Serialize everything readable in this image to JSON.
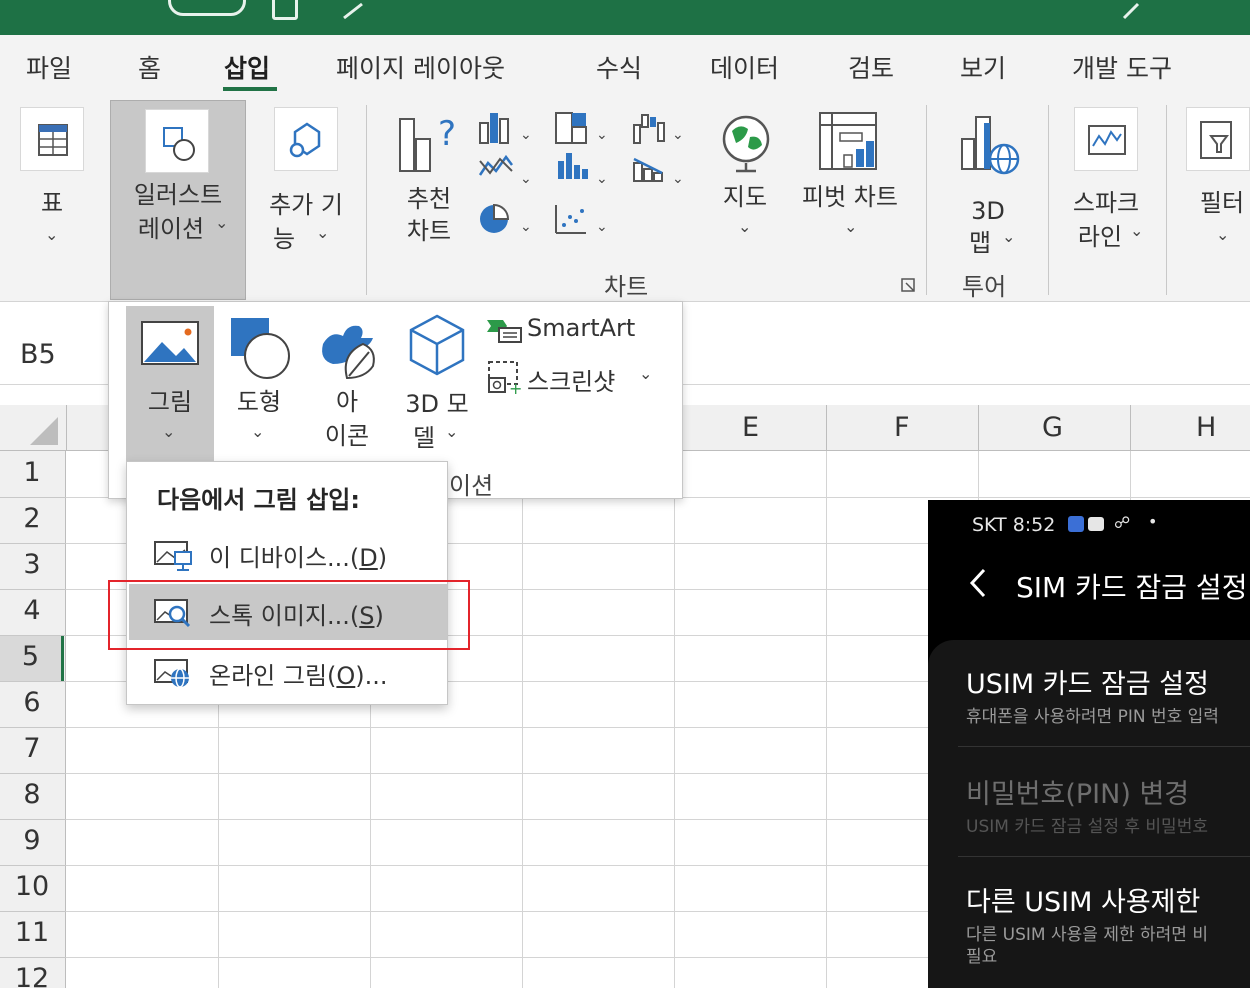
{
  "tabs": [
    "파일",
    "홈",
    "삽입",
    "페이지 레이아웃",
    "수식",
    "데이터",
    "검토",
    "보기",
    "개발 도구"
  ],
  "active_tab": "삽입",
  "ribbon": {
    "table": "표",
    "illustrations": [
      "일러스트",
      "레이션"
    ],
    "addins": [
      "추가 기",
      "능"
    ],
    "recommended_charts": [
      "추천",
      "차트"
    ],
    "maps": "지도",
    "pivot_chart": "피벗 차트",
    "map3d": [
      "3D",
      "맵"
    ],
    "sparkline": [
      "스파크",
      "라인"
    ],
    "filter": "필터",
    "group_chart": "차트",
    "group_tour": "투어"
  },
  "name_box": "B5",
  "columns": [
    "E",
    "F",
    "G",
    "H"
  ],
  "rows": [
    "1",
    "2",
    "3",
    "4",
    "5",
    "6",
    "7",
    "8",
    "9",
    "10",
    "11",
    "12"
  ],
  "illustrations_panel": {
    "picture": "그림",
    "shapes": "도형",
    "icons": [
      "아",
      "이콘"
    ],
    "model3d": [
      "3D 모",
      "델"
    ],
    "smartart": "SmartArt",
    "screenshot": "스크린샷",
    "group_suffix": "이션"
  },
  "picture_menu": {
    "header": "다음에서 그림 삽입:",
    "items": [
      {
        "text": "이 디바이스...(",
        "key": "D",
        "close": ")"
      },
      {
        "text": "스톡 이미지...(",
        "key": "S",
        "close": ")"
      },
      {
        "text": "온라인 그림(",
        "key": "O",
        "close": ")..."
      }
    ]
  },
  "phone": {
    "status": "SKT 8:52",
    "title": "SIM 카드 잠금 설정",
    "items": [
      {
        "title": "USIM 카드 잠금 설정",
        "subtitle": "휴대폰을 사용하려면 PIN 번호 입력"
      },
      {
        "title": "비밀번호(PIN) 변경",
        "subtitle": "USIM 카드 잠금 설정 후 비밀번호"
      },
      {
        "title": "다른 USIM 사용제한",
        "subtitle": "다른 USIM 사용을 제한 하려면 비",
        "subtitle2": "필요"
      }
    ]
  }
}
